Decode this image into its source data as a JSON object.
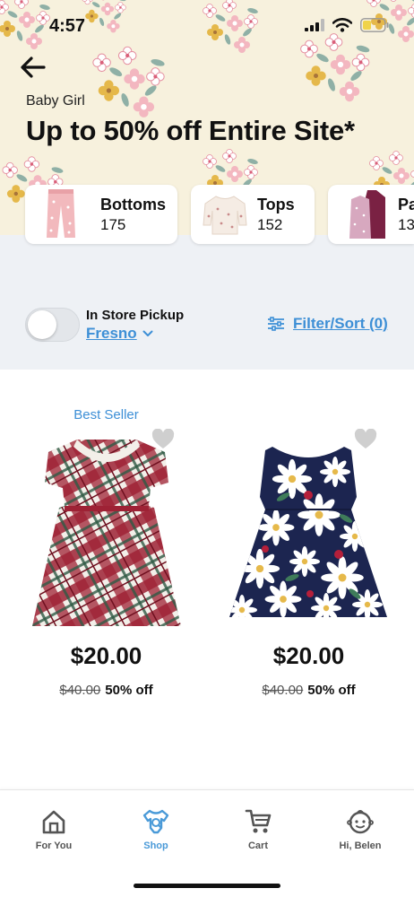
{
  "status_bar": {
    "time": "4:57"
  },
  "header": {
    "subtitle": "Baby Girl",
    "title": "Up to 50% off Entire Site*"
  },
  "categories": [
    {
      "name": "Bottoms",
      "count": "175"
    },
    {
      "name": "Tops",
      "count": "152"
    },
    {
      "name": "Pa",
      "count": "13"
    }
  ],
  "pickup": {
    "label": "In Store Pickup",
    "store": "Fresno",
    "enabled": false
  },
  "filter": {
    "label": "Filter/Sort (0)"
  },
  "products": [
    {
      "badge": "Best Seller",
      "price": "$20.00",
      "original_price": "$40.00",
      "discount": "50% off",
      "favorited": false
    },
    {
      "badge": "",
      "price": "$20.00",
      "original_price": "$40.00",
      "discount": "50% off",
      "favorited": false
    }
  ],
  "bottom_nav": [
    {
      "label": "For You",
      "icon": "home-icon",
      "active": false
    },
    {
      "label": "Shop",
      "icon": "shop-onesie-icon",
      "active": true
    },
    {
      "label": "Cart",
      "icon": "cart-icon",
      "active": false
    },
    {
      "label": "Hi, Belen",
      "icon": "baby-face-icon",
      "active": false
    }
  ],
  "colors": {
    "accent": "#3d8fd6",
    "banner_bg": "#f7f1dd",
    "gray_bg": "#eef1f5"
  }
}
